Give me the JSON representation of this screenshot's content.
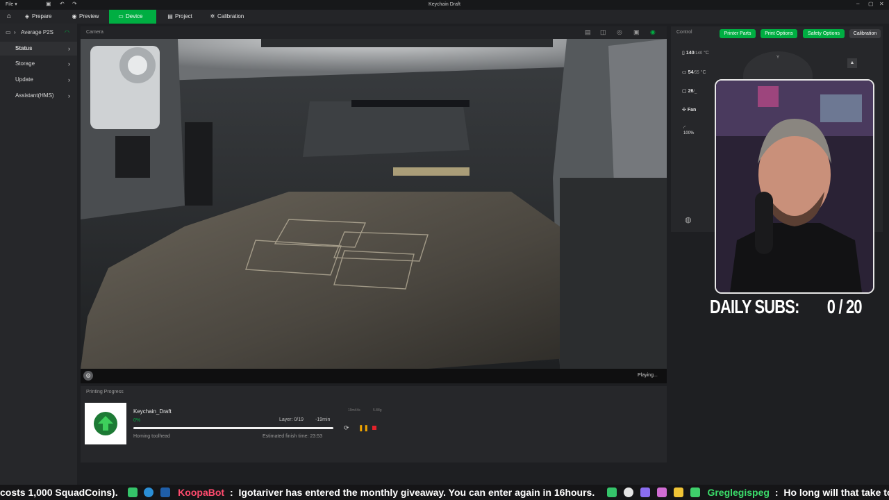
{
  "titlebar": {
    "file_label": "File",
    "title": "Keychain Draft"
  },
  "nav": {
    "items": [
      {
        "label": "Prepare"
      },
      {
        "label": "Preview"
      },
      {
        "label": "Device"
      },
      {
        "label": "Project"
      },
      {
        "label": "Calibration"
      }
    ]
  },
  "sidebar": {
    "printer": "Average P2S",
    "items": [
      {
        "label": "Status"
      },
      {
        "label": "Storage"
      },
      {
        "label": "Update"
      },
      {
        "label": "Assistant(HMS)"
      }
    ]
  },
  "camera": {
    "title": "Camera",
    "status": "Playing..."
  },
  "progress": {
    "section_title": "Printing Progress",
    "job_name": "Keychain_Draft",
    "percent_label": "0%",
    "percent": 0,
    "layer": "Layer: 0/19",
    "remaining": "-19min",
    "stage": "Homing toolhead",
    "finish": "Estimated finish time: 23:53",
    "time_label": "19m44s",
    "weight_label": "5.88g"
  },
  "control": {
    "title": "Control",
    "tabs": [
      {
        "label": "Printer Parts"
      },
      {
        "label": "Print Options"
      },
      {
        "label": "Safety Options"
      },
      {
        "label": "Calibration"
      }
    ],
    "nozzle_temp": "140",
    "nozzle_target": "/140",
    "bed_temp": "54",
    "bed_target": "/55",
    "chamber_temp": "26",
    "chamber_target": "/_",
    "unit": "°C",
    "fan_label": "Fan",
    "speed_label": "100%",
    "jog_y_label": "Y",
    "accent": "#00ae42"
  },
  "overlay": {
    "subs_label": "DAILY SUBS:",
    "subs_value": "0 / 20"
  },
  "ticker": {
    "lead": "costs 1,000 SquadCoins).",
    "bot_name": "KoopaBot",
    "bot_sep": ":",
    "bot_msg": "Igotariver has entered the monthly giveaway. You can enter again in 16hours.",
    "user_name": "Greglegispeg",
    "user_sep": ":",
    "user_msg": "Ho long will that take to print?"
  }
}
